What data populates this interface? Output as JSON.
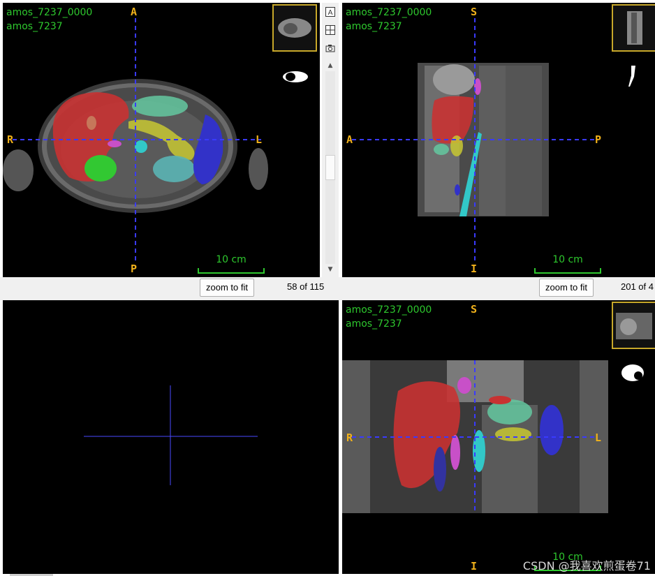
{
  "views": {
    "axial": {
      "title_line1": "amos_7237_0000",
      "title_line2": "amos_7237",
      "orient_top": "A",
      "orient_bottom": "P",
      "orient_left": "R",
      "orient_right": "L",
      "scale_label": "10 cm",
      "zoom_button": "zoom to fit",
      "slice_status": "58 of 115"
    },
    "sagittal": {
      "title_line1": "amos_7237_0000",
      "title_line2": "amos_7237",
      "orient_top": "S",
      "orient_bottom": "I",
      "orient_left": "A",
      "orient_right": "P",
      "scale_label": "10 cm",
      "zoom_button": "zoom to fit",
      "slice_status": "201 of 4"
    },
    "coronal": {
      "title_line1": "amos_7237_0000",
      "title_line2": "amos_7237",
      "orient_top": "S",
      "orient_bottom": "I",
      "orient_left": "R",
      "orient_right": "L",
      "scale_label": "10 cm"
    }
  },
  "toolbar": {
    "icons": [
      "annotation-icon",
      "layout-icon",
      "camera-icon"
    ]
  },
  "colors": {
    "label_green": "#2ec82e",
    "orient_orange": "#f2b21b",
    "crosshair_blue": "#3a3aff",
    "liver": "#c83232",
    "spleen": "#3232c8",
    "kidney": "#32c832",
    "stomach": "#64c8a0",
    "pancreas": "#c8c832",
    "aorta": "#32c8c8",
    "gallbladder": "#c850c8"
  },
  "watermark": "CSDN @我喜欢煎蛋卷71"
}
